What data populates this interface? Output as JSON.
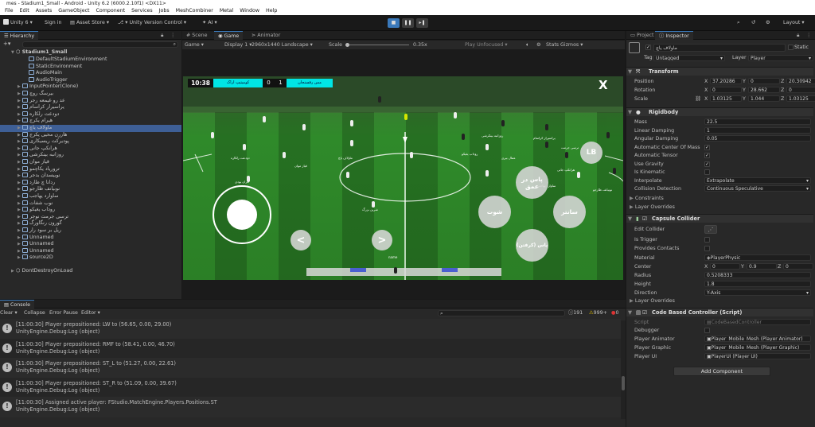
{
  "window": {
    "title": "mes - Stadium1_Small - Android - Unity 6.2 (6000.2.10f1) <DX11>"
  },
  "menu": [
    "File",
    "Edit",
    "Assets",
    "GameObject",
    "Component",
    "Services",
    "Jobs",
    "MeshCombiner",
    "Metal",
    "Window",
    "Help"
  ],
  "toolbar": {
    "account": "Unity 6",
    "signin": "Sign in",
    "asset_store": "Asset Store",
    "version_control": "Unity Version Control",
    "ai": "AI",
    "layout": "Layout"
  },
  "hierarchy": {
    "tab": "Hierarchy",
    "scene": "Stadium1_Small",
    "items": [
      "DefaultStadiumEnvironment",
      "StaticEnvironment",
      "AudioMain",
      "AudioTrigger",
      "InputPointer(Clone)",
      "بیرسگ روچ",
      "عد رو غیمعه رجر",
      "یراسیرار کراسام",
      "دودعت رلکاره",
      "هیرام یکرج",
      "ماولاف یاچ",
      "هاررن محیی یکرج",
      "پودیرکت ریسیکاری",
      "هرانکپ جانی",
      "روزانبه بینکرشی",
      "قیاز موان",
      "تروریاد یکاچمو",
      "نوبیسدان بدجر",
      "ردانا چ طارد",
      "نوبیانف ظارجو",
      "ساوارد یهاجب",
      "نوب شفات",
      "روداب یغیکو",
      "ترسی جرمت نوجر",
      "گورون رنگاورگ",
      "ریل بر سود رار",
      "Unnamed",
      "Unnamed",
      "Unnamed",
      "source2D"
    ],
    "dont_destroy": "DontDestroyOnLoad"
  },
  "scene_tabs": {
    "scene": "Scene",
    "game": "Game",
    "animator": "Animator"
  },
  "game_bar": {
    "view": "Game",
    "display": "Display 1",
    "resolution": "2960x1440 Landscape",
    "scale_label": "Scale",
    "scale_value": "0.35x",
    "play_mode": "Play Unfocused",
    "stats": "Stats",
    "gizmos": "Gizmos"
  },
  "game": {
    "time": "10:38",
    "team_left": "کومیتیپ اراک",
    "score_left": "0",
    "score_right": "1",
    "team_right": "مس رفسنجان",
    "close": "X",
    "lb": "LB",
    "btn_through": "پاس در عمق",
    "btn_shoot": "شوت",
    "btn_center": "سانتر",
    "btn_pass": "پاس (کرفتن)",
    "prev": "<",
    "next": ">",
    "player_tags": [
      "دودعت رلکاره",
      "ماولاف یاچ",
      "روداب یغیکو",
      "عمال بیری",
      "هرانکپ جانی",
      "نوبیانف ظارجو",
      "یراسیرار کراسام",
      "روزانبه بینکرشی",
      "مران بودی",
      "قیاز موان",
      "شرین بزرگ",
      "ساوارد یهاجب",
      "ترسی جرمت",
      "name"
    ]
  },
  "console": {
    "tab": "Console",
    "buttons": [
      "Clear",
      "Collapse",
      "Error Pause",
      "Editor"
    ],
    "counts": {
      "info": "191",
      "warn": "999+",
      "error": "0"
    },
    "entries": [
      {
        "line1": "[11:00:30] Player prepositioned: LW to (56.65, 0.00, 29.00)",
        "line2": "UnityEngine.Debug:Log (object)"
      },
      {
        "line1": "[11:00:30] Player prepositioned: RMF to (58.41, 0.00, 46.70)",
        "line2": "UnityEngine.Debug:Log (object)"
      },
      {
        "line1": "[11:00:30] Player prepositioned: ST_L to (51.27, 0.00, 22.61)",
        "line2": "UnityEngine.Debug:Log (object)"
      },
      {
        "line1": "[11:00:30] Player prepositioned: ST_R to (51.09, 0.00, 39.67)",
        "line2": "UnityEngine.Debug:Log (object)"
      },
      {
        "line1": "[11:00:30] Assigned active player: FStudio.MatchEngine.Players.Positions.ST",
        "line2": "UnityEngine.Debug:Log (object)"
      }
    ]
  },
  "inspector": {
    "tabs": {
      "project": "Project",
      "inspector": "Inspector"
    },
    "object_name": "ماولاف یاچ",
    "static": "Static",
    "tag_label": "Tag",
    "tag": "Untagged",
    "layer_label": "Layer",
    "layer": "Player",
    "transform": {
      "title": "Transform",
      "position_label": "Position",
      "rotation_label": "Rotation",
      "scale_label": "Scale",
      "position": [
        "37.20286",
        "0",
        "20.30942"
      ],
      "rotation": [
        "0",
        "28.662",
        "0"
      ],
      "scale": [
        "1.03125",
        "1.044",
        "1.03125"
      ]
    },
    "rigidbody": {
      "title": "Rigidbody",
      "rows": [
        {
          "label": "Mass",
          "value": "22.5"
        },
        {
          "label": "Linear Damping",
          "value": "1"
        },
        {
          "label": "Angular Damping",
          "value": "0.05"
        },
        {
          "label": "Automatic Center Of Mass",
          "check": "✓"
        },
        {
          "label": "Automatic Tensor",
          "check": "✓"
        },
        {
          "label": "Use Gravity",
          "check": "✓"
        },
        {
          "label": "Is Kinematic",
          "check": ""
        },
        {
          "label": "Interpolate",
          "value": "Extrapolate"
        },
        {
          "label": "Collision Detection",
          "value": "Continuous Speculative"
        }
      ],
      "constraints": "Constraints",
      "layer_overrides": "Layer Overrides"
    },
    "capsule": {
      "title": "Capsule Collider",
      "edit": "Edit Collider",
      "is_trigger": "Is Trigger",
      "provides_contacts": "Provides Contacts",
      "material_label": "Material",
      "material": "PlayerPhysic",
      "center_label": "Center",
      "center": [
        "0",
        "0.9",
        "0"
      ],
      "radius_label": "Radius",
      "radius": "0.5208333",
      "height_label": "Height",
      "height": "1.8",
      "direction_label": "Direction",
      "direction": "Y-Axis",
      "layer_overrides": "Layer Overrides"
    },
    "script": {
      "title": "Code Based Controller (Script)",
      "script_label": "Script",
      "script": "CodeBasedController",
      "debugger": "Debugger",
      "animator_label": "Player Animator",
      "animator": "Player_Mobile_Mesh (Player Animator)",
      "graphic_label": "Player Graphic",
      "graphic": "Player_Mobile_Mesh (Player Graphic)",
      "ui_label": "Player UI",
      "ui": "PlayerUI (Player UI)"
    },
    "add_component": "Add Component"
  },
  "colors": {
    "accent": "#3a79bb",
    "team_bar": "#00e5e5",
    "pitch": "#2f8a2a",
    "selected": "#3e5f96"
  }
}
